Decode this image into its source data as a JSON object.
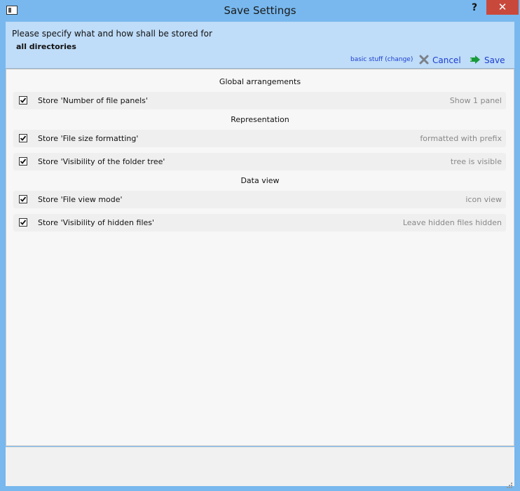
{
  "window": {
    "title": "Save Settings",
    "help_label": "?",
    "close_label": "✕"
  },
  "header": {
    "prompt": "Please specify what and how shall be stored for",
    "scope": "all directories",
    "change_link": "basic stuff (change)",
    "cancel_label": "Cancel",
    "save_label": "Save"
  },
  "sections": [
    {
      "title": "Global arrangements",
      "items": [
        {
          "label": "Store 'Number of file panels'",
          "value": "Show 1 panel",
          "checked": true
        }
      ]
    },
    {
      "title": "Representation",
      "items": [
        {
          "label": "Store 'File size formatting'",
          "value": "formatted with prefix",
          "checked": true
        },
        {
          "label": "Store 'Visibility of the folder tree'",
          "value": "tree is visible",
          "checked": true
        }
      ]
    },
    {
      "title": "Data view",
      "items": [
        {
          "label": "Store 'File view mode'",
          "value": "icon view",
          "checked": true
        },
        {
          "label": "Store 'Visibility of hidden files'",
          "value": "Leave hidden files hidden",
          "checked": true
        }
      ]
    }
  ],
  "colors": {
    "title_bar": "#78b8ee",
    "header_bg": "#bfdcf8",
    "link": "#1c3fd0",
    "close": "#c9483c",
    "save_arrow": "#1a9a3c"
  },
  "icons": {
    "app": "window-icon",
    "cancel": "x-icon",
    "save": "arrow-right-icon"
  }
}
